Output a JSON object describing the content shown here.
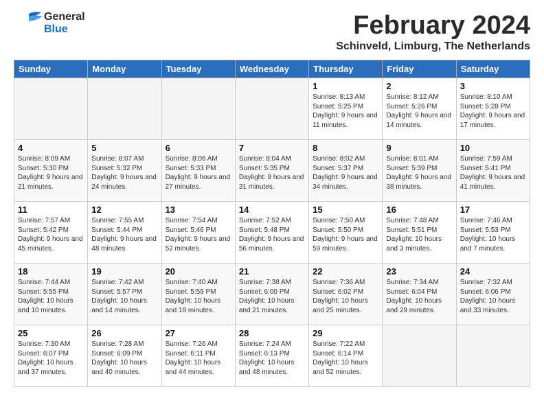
{
  "header": {
    "logo": {
      "text_general": "General",
      "text_blue": "Blue"
    },
    "title": "February 2024",
    "location": "Schinveld, Limburg, The Netherlands"
  },
  "calendar": {
    "days_of_week": [
      "Sunday",
      "Monday",
      "Tuesday",
      "Wednesday",
      "Thursday",
      "Friday",
      "Saturday"
    ],
    "weeks": [
      [
        {
          "day": "",
          "empty": true
        },
        {
          "day": "",
          "empty": true
        },
        {
          "day": "",
          "empty": true
        },
        {
          "day": "",
          "empty": true
        },
        {
          "day": "1",
          "sunrise": "8:13 AM",
          "sunset": "5:25 PM",
          "daylight": "9 hours and 11 minutes."
        },
        {
          "day": "2",
          "sunrise": "8:12 AM",
          "sunset": "5:26 PM",
          "daylight": "9 hours and 14 minutes."
        },
        {
          "day": "3",
          "sunrise": "8:10 AM",
          "sunset": "5:28 PM",
          "daylight": "9 hours and 17 minutes."
        }
      ],
      [
        {
          "day": "4",
          "sunrise": "8:09 AM",
          "sunset": "5:30 PM",
          "daylight": "9 hours and 21 minutes."
        },
        {
          "day": "5",
          "sunrise": "8:07 AM",
          "sunset": "5:32 PM",
          "daylight": "9 hours and 24 minutes."
        },
        {
          "day": "6",
          "sunrise": "8:06 AM",
          "sunset": "5:33 PM",
          "daylight": "9 hours and 27 minutes."
        },
        {
          "day": "7",
          "sunrise": "8:04 AM",
          "sunset": "5:35 PM",
          "daylight": "9 hours and 31 minutes."
        },
        {
          "day": "8",
          "sunrise": "8:02 AM",
          "sunset": "5:37 PM",
          "daylight": "9 hours and 34 minutes."
        },
        {
          "day": "9",
          "sunrise": "8:01 AM",
          "sunset": "5:39 PM",
          "daylight": "9 hours and 38 minutes."
        },
        {
          "day": "10",
          "sunrise": "7:59 AM",
          "sunset": "5:41 PM",
          "daylight": "9 hours and 41 minutes."
        }
      ],
      [
        {
          "day": "11",
          "sunrise": "7:57 AM",
          "sunset": "5:42 PM",
          "daylight": "9 hours and 45 minutes."
        },
        {
          "day": "12",
          "sunrise": "7:55 AM",
          "sunset": "5:44 PM",
          "daylight": "9 hours and 48 minutes."
        },
        {
          "day": "13",
          "sunrise": "7:54 AM",
          "sunset": "5:46 PM",
          "daylight": "9 hours and 52 minutes."
        },
        {
          "day": "14",
          "sunrise": "7:52 AM",
          "sunset": "5:48 PM",
          "daylight": "9 hours and 56 minutes."
        },
        {
          "day": "15",
          "sunrise": "7:50 AM",
          "sunset": "5:50 PM",
          "daylight": "9 hours and 59 minutes."
        },
        {
          "day": "16",
          "sunrise": "7:48 AM",
          "sunset": "5:51 PM",
          "daylight": "10 hours and 3 minutes."
        },
        {
          "day": "17",
          "sunrise": "7:46 AM",
          "sunset": "5:53 PM",
          "daylight": "10 hours and 7 minutes."
        }
      ],
      [
        {
          "day": "18",
          "sunrise": "7:44 AM",
          "sunset": "5:55 PM",
          "daylight": "10 hours and 10 minutes."
        },
        {
          "day": "19",
          "sunrise": "7:42 AM",
          "sunset": "5:57 PM",
          "daylight": "10 hours and 14 minutes."
        },
        {
          "day": "20",
          "sunrise": "7:40 AM",
          "sunset": "5:59 PM",
          "daylight": "10 hours and 18 minutes."
        },
        {
          "day": "21",
          "sunrise": "7:38 AM",
          "sunset": "6:00 PM",
          "daylight": "10 hours and 21 minutes."
        },
        {
          "day": "22",
          "sunrise": "7:36 AM",
          "sunset": "6:02 PM",
          "daylight": "10 hours and 25 minutes."
        },
        {
          "day": "23",
          "sunrise": "7:34 AM",
          "sunset": "6:04 PM",
          "daylight": "10 hours and 29 minutes."
        },
        {
          "day": "24",
          "sunrise": "7:32 AM",
          "sunset": "6:06 PM",
          "daylight": "10 hours and 33 minutes."
        }
      ],
      [
        {
          "day": "25",
          "sunrise": "7:30 AM",
          "sunset": "6:07 PM",
          "daylight": "10 hours and 37 minutes."
        },
        {
          "day": "26",
          "sunrise": "7:28 AM",
          "sunset": "6:09 PM",
          "daylight": "10 hours and 40 minutes."
        },
        {
          "day": "27",
          "sunrise": "7:26 AM",
          "sunset": "6:11 PM",
          "daylight": "10 hours and 44 minutes."
        },
        {
          "day": "28",
          "sunrise": "7:24 AM",
          "sunset": "6:13 PM",
          "daylight": "10 hours and 48 minutes."
        },
        {
          "day": "29",
          "sunrise": "7:22 AM",
          "sunset": "6:14 PM",
          "daylight": "10 hours and 52 minutes."
        },
        {
          "day": "",
          "empty": true
        },
        {
          "day": "",
          "empty": true
        }
      ]
    ]
  }
}
